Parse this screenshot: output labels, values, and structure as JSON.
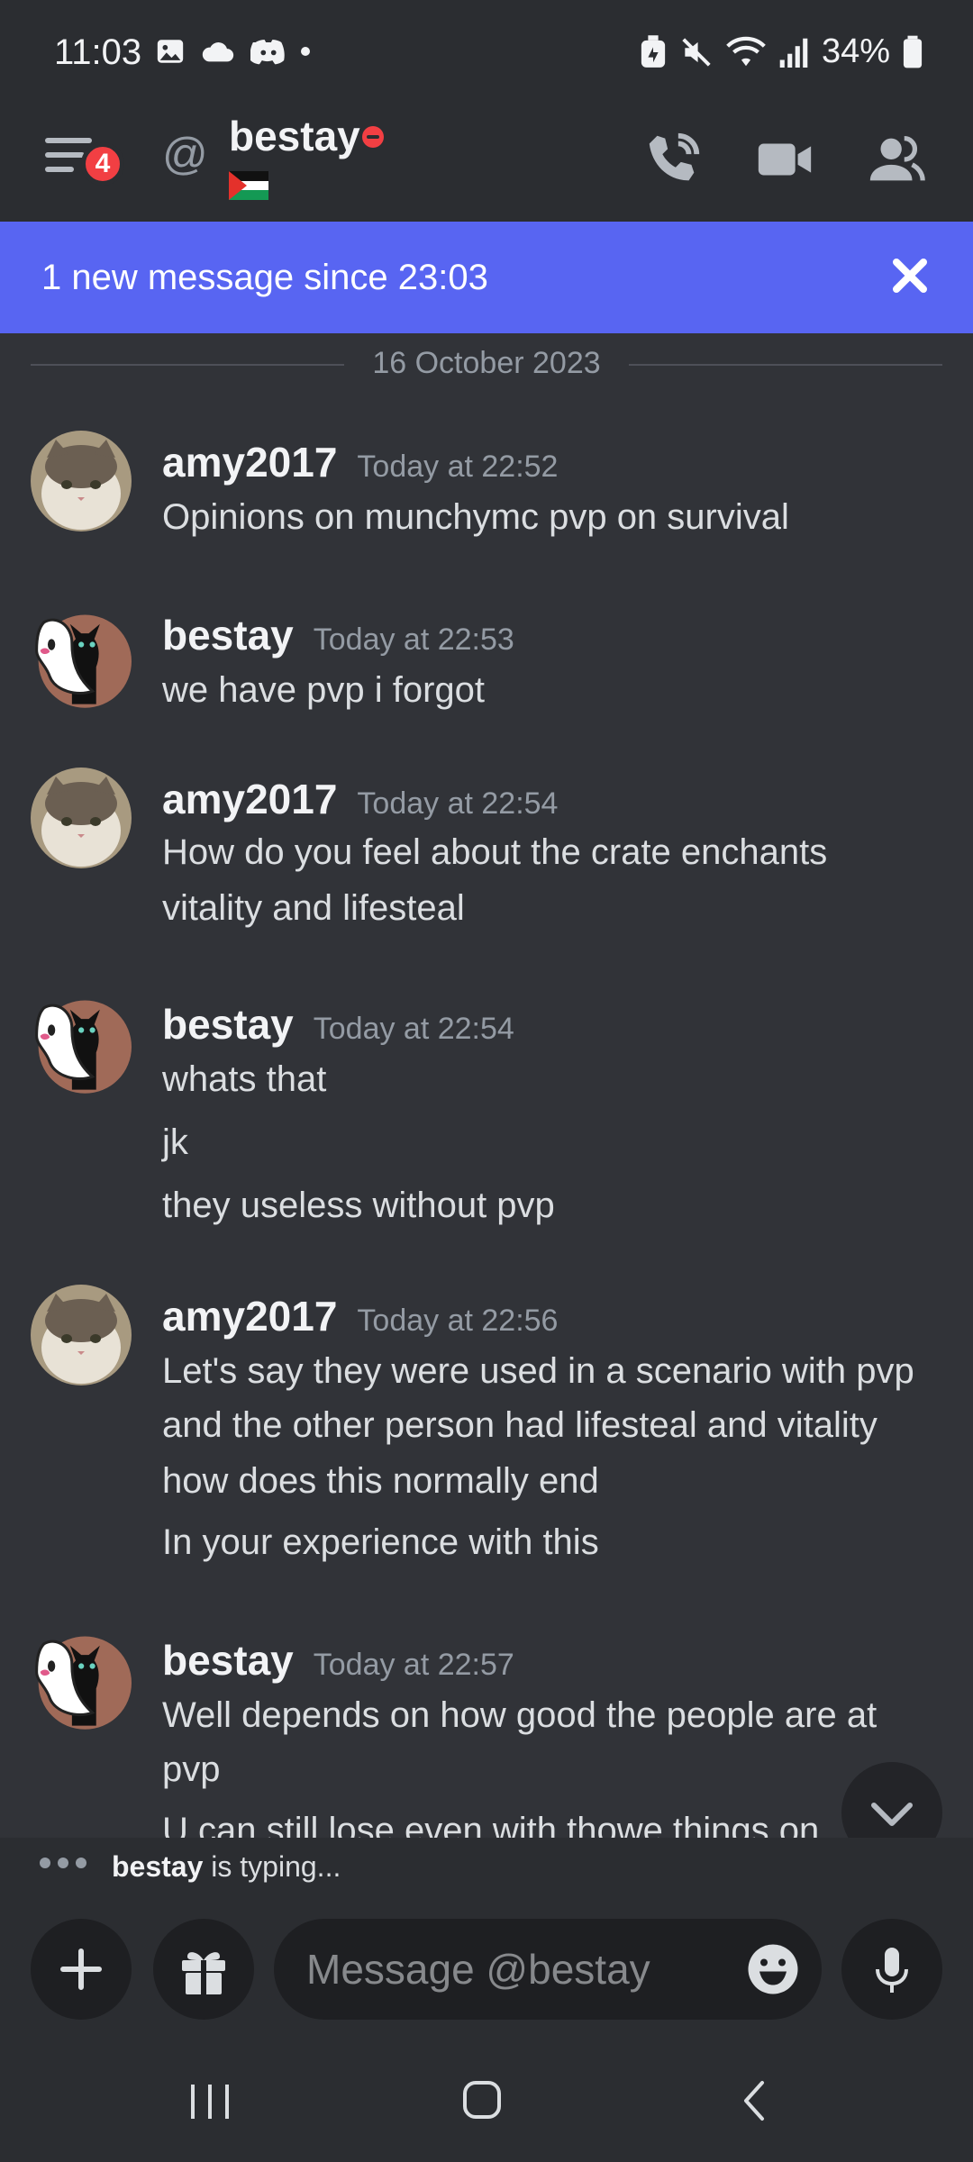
{
  "status_bar": {
    "time": "11:03",
    "battery": "34%"
  },
  "header": {
    "notification_count": "4",
    "username": "bestay"
  },
  "banner": {
    "text": "1 new message since 23:03"
  },
  "date_divider": "16 October 2023",
  "messages": [
    {
      "author": "amy2017",
      "timestamp": "Today at 22:52",
      "lines": [
        "Opinions on munchymc pvp on survival"
      ]
    },
    {
      "author": "bestay",
      "timestamp": "Today at 22:53",
      "lines": [
        "we have  pvp i forgot"
      ]
    },
    {
      "author": "amy2017",
      "timestamp": "Today at 22:54",
      "lines": [
        "How do you feel about the crate enchants",
        "vitality and lifesteal"
      ]
    },
    {
      "author": "bestay",
      "timestamp": "Today at 22:54",
      "lines": [
        "whats that",
        "jk",
        "they useless without pvp"
      ]
    },
    {
      "author": "amy2017",
      "timestamp": "Today at 22:56",
      "lines": [
        "Let's say they were used in a scenario with pvp",
        "and the other person had lifesteal and vitality",
        "how does this normally end",
        "In your experience with this"
      ]
    },
    {
      "author": "bestay",
      "timestamp": "Today at 22:57",
      "lines": [
        "Well depends on how good the people are at",
        "pvp",
        "U can still lose even with thowe things on"
      ]
    }
  ],
  "typing": {
    "user": "bestay",
    "suffix": " is typing..."
  },
  "composer": {
    "placeholder": "Message @bestay"
  },
  "colors": {
    "background": "#313338",
    "header": "#2b2d31",
    "banner": "#5865f2",
    "badge": "#f23f43"
  }
}
